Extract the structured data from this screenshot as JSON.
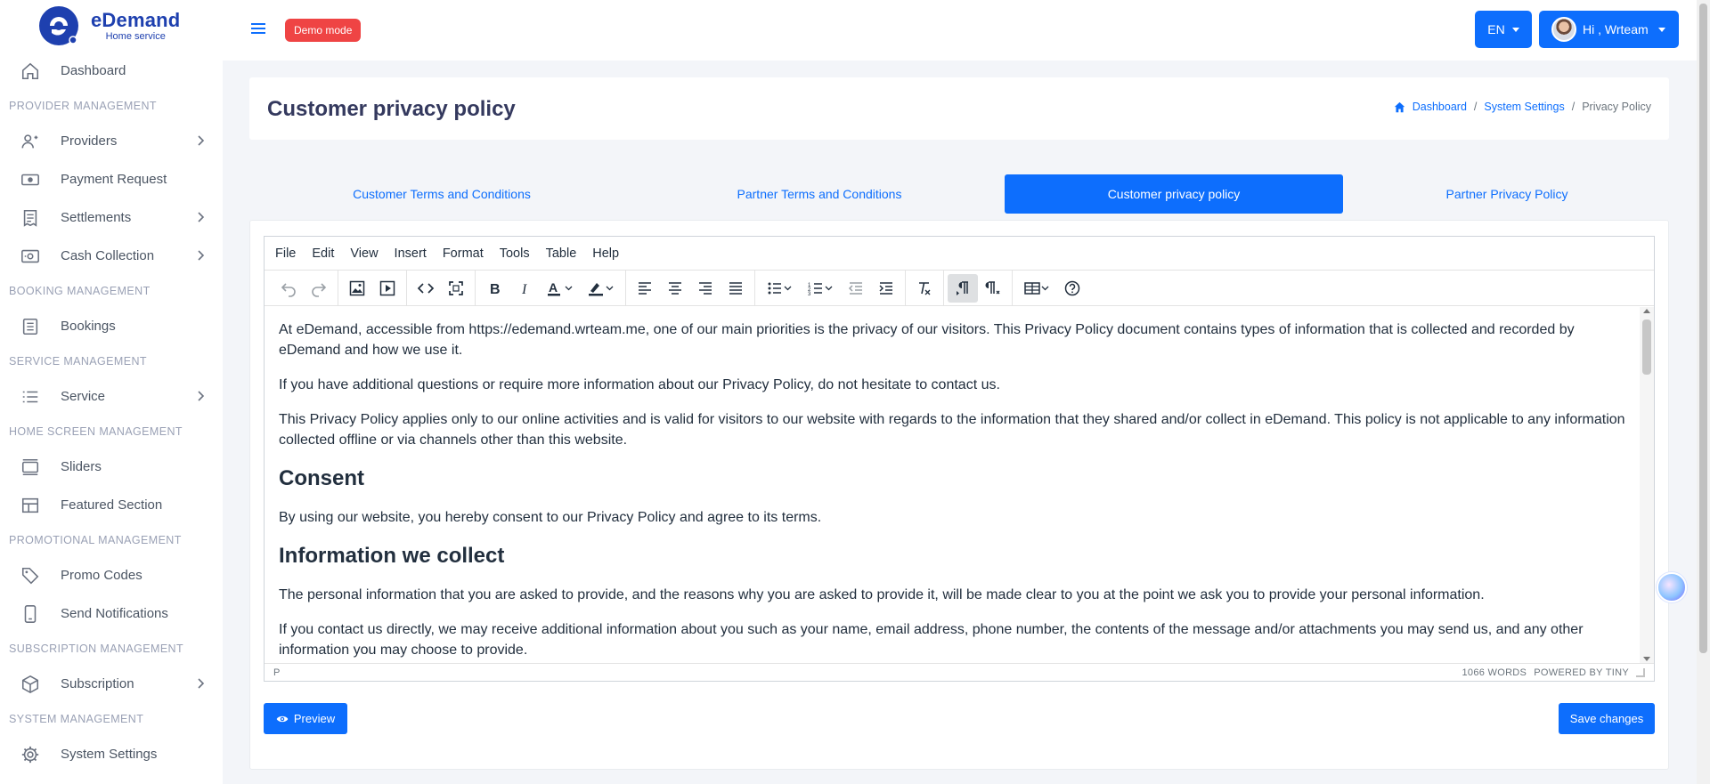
{
  "brand": {
    "name": "eDemand",
    "sub": "Home service"
  },
  "sidebar": {
    "items": [
      {
        "type": "item",
        "label": "Dashboard",
        "icon": "home-icon",
        "chevron": false
      },
      {
        "type": "header",
        "label": "PROVIDER MANAGEMENT"
      },
      {
        "type": "item",
        "label": "Providers",
        "icon": "users-icon",
        "chevron": true
      },
      {
        "type": "item",
        "label": "Payment Request",
        "icon": "money-icon",
        "chevron": false
      },
      {
        "type": "item",
        "label": "Settlements",
        "icon": "receipt-icon",
        "chevron": true
      },
      {
        "type": "item",
        "label": "Cash Collection",
        "icon": "cash-icon",
        "chevron": true
      },
      {
        "type": "header",
        "label": "BOOKING MANAGEMENT"
      },
      {
        "type": "item",
        "label": "Bookings",
        "icon": "list-box-icon",
        "chevron": false
      },
      {
        "type": "header",
        "label": "SERVICE MANAGEMENT"
      },
      {
        "type": "item",
        "label": "Service",
        "icon": "list-icon",
        "chevron": true
      },
      {
        "type": "header",
        "label": "HOME SCREEN MANAGEMENT"
      },
      {
        "type": "item",
        "label": "Sliders",
        "icon": "sliders-icon",
        "chevron": false
      },
      {
        "type": "item",
        "label": "Featured Section",
        "icon": "layout-icon",
        "chevron": false
      },
      {
        "type": "header",
        "label": "PROMOTIONAL MANAGEMENT"
      },
      {
        "type": "item",
        "label": "Promo Codes",
        "icon": "tag-icon",
        "chevron": false
      },
      {
        "type": "item",
        "label": "Send Notifications",
        "icon": "phone-icon",
        "chevron": false
      },
      {
        "type": "header",
        "label": "SUBSCRIPTION MANAGEMENT"
      },
      {
        "type": "item",
        "label": "Subscription",
        "icon": "box-icon",
        "chevron": true
      },
      {
        "type": "header",
        "label": "SYSTEM MANAGEMENT"
      },
      {
        "type": "item",
        "label": "System Settings",
        "icon": "gear-icon",
        "chevron": false
      }
    ]
  },
  "topbar": {
    "demo": "Demo mode",
    "lang": "EN",
    "user": "Hi , Wrteam"
  },
  "page": {
    "title": "Customer privacy policy"
  },
  "breadcrumb": {
    "home": "Dashboard",
    "settings": "System Settings",
    "current": "Privacy Policy"
  },
  "tabs": [
    {
      "label": "Customer Terms and Conditions",
      "active": false
    },
    {
      "label": "Partner Terms and Conditions",
      "active": false
    },
    {
      "label": "Customer privacy policy",
      "active": true
    },
    {
      "label": "Partner Privacy Policy",
      "active": false
    }
  ],
  "editor": {
    "menu": [
      "File",
      "Edit",
      "View",
      "Insert",
      "Format",
      "Tools",
      "Table",
      "Help"
    ],
    "content": [
      {
        "tag": "p",
        "text": "At eDemand, accessible from https://edemand.wrteam.me, one of our main priorities is the privacy of our visitors. This Privacy Policy document contains types of information that is collected and recorded by eDemand and how we use it."
      },
      {
        "tag": "p",
        "text": "If you have additional questions or require more information about our Privacy Policy, do not hesitate to contact us."
      },
      {
        "tag": "p",
        "text": "This Privacy Policy applies only to our online activities and is valid for visitors to our website with regards to the information that they shared and/or collect in eDemand. This policy is not applicable to any information collected offline or via channels other than this website."
      },
      {
        "tag": "h2",
        "text": "Consent"
      },
      {
        "tag": "p",
        "text": "By using our website, you hereby consent to our Privacy Policy and agree to its terms."
      },
      {
        "tag": "h2",
        "text": "Information we collect"
      },
      {
        "tag": "p",
        "text": "The personal information that you are asked to provide, and the reasons why you are asked to provide it, will be made clear to you at the point we ask you to provide your personal information."
      },
      {
        "tag": "p",
        "text": "If you contact us directly, we may receive additional information about you such as your name, email address, phone number, the contents of the message and/or attachments you may send us, and any other information you may choose to provide."
      }
    ],
    "status_path": "P",
    "word_count": "1066 WORDS",
    "powered": "POWERED BY TINY"
  },
  "buttons": {
    "preview": "Preview",
    "save": "Save changes"
  },
  "colors": {
    "primary": "#0d6efd",
    "danger": "#ef4444",
    "brand": "#1e40af"
  }
}
